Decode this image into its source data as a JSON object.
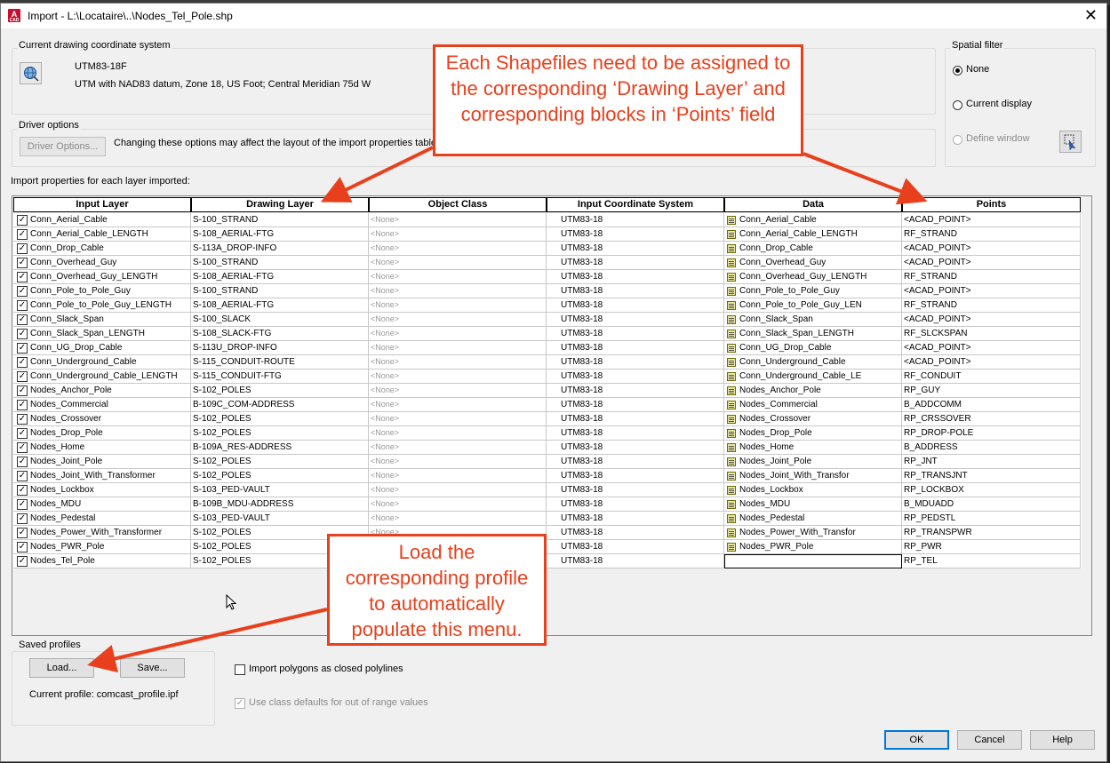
{
  "window": {
    "title": "Import - L:\\Locataire\\..\\Nodes_Tel_Pole.shp",
    "app_icon": "autocad-icon",
    "app_icon_letter": "A",
    "app_icon_sub": "CAD",
    "close_glyph": "✕"
  },
  "coord_system": {
    "group_label": "Current drawing coordinate system",
    "code": "UTM83-18F",
    "description": "UTM with NAD83 datum, Zone 18, US Foot; Central Meridian 75d W",
    "icon": "globe-icon"
  },
  "driver_options": {
    "group_label": "Driver options",
    "button_label": "Driver Options...",
    "note": "Changing these options may affect the layout of the import properties table."
  },
  "spatial_filter": {
    "group_label": "Spatial filter",
    "options": [
      "None",
      "Current display",
      "Define window"
    ],
    "selected": "None",
    "pick_icon": "select-window-icon"
  },
  "table": {
    "label": "Import properties for each layer imported:",
    "columns": [
      "Input Layer",
      "Drawing Layer",
      "Object Class",
      "Input Coordinate System",
      "Data",
      "Points"
    ],
    "rows": [
      [
        "Conn_Aerial_Cable",
        "S-100_STRAND",
        "<None>",
        "UTM83-18",
        "Conn_Aerial_Cable",
        "<ACAD_POINT>"
      ],
      [
        "Conn_Aerial_Cable_LENGTH",
        "S-108_AERIAL-FTG",
        "<None>",
        "UTM83-18",
        "Conn_Aerial_Cable_LENGTH",
        "RF_STRAND"
      ],
      [
        "Conn_Drop_Cable",
        "S-113A_DROP-INFO",
        "<None>",
        "UTM83-18",
        "Conn_Drop_Cable",
        "<ACAD_POINT>"
      ],
      [
        "Conn_Overhead_Guy",
        "S-100_STRAND",
        "<None>",
        "UTM83-18",
        "Conn_Overhead_Guy",
        "<ACAD_POINT>"
      ],
      [
        "Conn_Overhead_Guy_LENGTH",
        "S-108_AERIAL-FTG",
        "<None>",
        "UTM83-18",
        "Conn_Overhead_Guy_LENGTH",
        "RF_STRAND"
      ],
      [
        "Conn_Pole_to_Pole_Guy",
        "S-100_STRAND",
        "<None>",
        "UTM83-18",
        "Conn_Pole_to_Pole_Guy",
        "<ACAD_POINT>"
      ],
      [
        "Conn_Pole_to_Pole_Guy_LENGTH",
        "S-108_AERIAL-FTG",
        "<None>",
        "UTM83-18",
        "Conn_Pole_to_Pole_Guy_LEN",
        "RF_STRAND"
      ],
      [
        "Conn_Slack_Span",
        "S-100_SLACK",
        "<None>",
        "UTM83-18",
        "Conn_Slack_Span",
        "<ACAD_POINT>"
      ],
      [
        "Conn_Slack_Span_LENGTH",
        "S-108_SLACK-FTG",
        "<None>",
        "UTM83-18",
        "Conn_Slack_Span_LENGTH",
        "RF_SLCKSPAN"
      ],
      [
        "Conn_UG_Drop_Cable",
        "S-113U_DROP-INFO",
        "<None>",
        "UTM83-18",
        "Conn_UG_Drop_Cable",
        "<ACAD_POINT>"
      ],
      [
        "Conn_Underground_Cable",
        "S-115_CONDUIT-ROUTE",
        "<None>",
        "UTM83-18",
        "Conn_Underground_Cable",
        "<ACAD_POINT>"
      ],
      [
        "Conn_Underground_Cable_LENGTH",
        "S-115_CONDUIT-FTG",
        "<None>",
        "UTM83-18",
        "Conn_Underground_Cable_LE",
        "RF_CONDUIT"
      ],
      [
        "Nodes_Anchor_Pole",
        "S-102_POLES",
        "<None>",
        "UTM83-18",
        "Nodes_Anchor_Pole",
        "RP_GUY"
      ],
      [
        "Nodes_Commercial",
        "B-109C_COM-ADDRESS",
        "<None>",
        "UTM83-18",
        "Nodes_Commercial",
        "B_ADDCOMM"
      ],
      [
        "Nodes_Crossover",
        "S-102_POLES",
        "<None>",
        "UTM83-18",
        "Nodes_Crossover",
        "RP_CRSSOVER"
      ],
      [
        "Nodes_Drop_Pole",
        "S-102_POLES",
        "<None>",
        "UTM83-18",
        "Nodes_Drop_Pole",
        "RP_DROP-POLE"
      ],
      [
        "Nodes_Home",
        "B-109A_RES-ADDRESS",
        "<None>",
        "UTM83-18",
        "Nodes_Home",
        "B_ADDRESS"
      ],
      [
        "Nodes_Joint_Pole",
        "S-102_POLES",
        "<None>",
        "UTM83-18",
        "Nodes_Joint_Pole",
        "RP_JNT"
      ],
      [
        "Nodes_Joint_With_Transformer",
        "S-102_POLES",
        "<None>",
        "UTM83-18",
        "Nodes_Joint_With_Transfor",
        "RP_TRANSJNT"
      ],
      [
        "Nodes_Lockbox",
        "S-103_PED-VAULT",
        "<None>",
        "UTM83-18",
        "Nodes_Lockbox",
        "RP_LOCKBOX"
      ],
      [
        "Nodes_MDU",
        "B-109B_MDU-ADDRESS",
        "<None>",
        "UTM83-18",
        "Nodes_MDU",
        "B_MDUADD"
      ],
      [
        "Nodes_Pedestal",
        "S-103_PED-VAULT",
        "<None>",
        "UTM83-18",
        "Nodes_Pedestal",
        "RP_PEDSTL"
      ],
      [
        "Nodes_Power_With_Transformer",
        "S-102_POLES",
        "<None>",
        "UTM83-18",
        "Nodes_Power_With_Transfor",
        "RP_TRANSPWR"
      ],
      [
        "Nodes_PWR_Pole",
        "S-102_POLES",
        "<None>",
        "UTM83-18",
        "Nodes_PWR_Pole",
        "RP_PWR"
      ],
      [
        "Nodes_Tel_Pole",
        "S-102_POLES",
        "",
        "UTM83-18",
        "",
        "RP_TEL"
      ]
    ],
    "checked": true,
    "check_glyph": "✓"
  },
  "saved_profiles": {
    "group_label": "Saved profiles",
    "load_label": "Load...",
    "save_label": "Save...",
    "current_profile": "Current profile: comcast_profile.ipf"
  },
  "options": {
    "import_polygons_label": "Import polygons as closed polylines",
    "import_polygons_checked": false,
    "class_defaults_label": "Use class defaults for out of range values",
    "class_defaults_checked": true
  },
  "buttons": {
    "ok": "OK",
    "cancel": "Cancel",
    "help": "Help"
  },
  "annotations": {
    "top": "Each Shapefiles need to be assigned to the corresponding ‘Drawing Layer’ and corresponding blocks in ‘Points’ field",
    "bottom": "Load the corresponding profile to automatically populate this menu.",
    "color": "#e8401c"
  }
}
